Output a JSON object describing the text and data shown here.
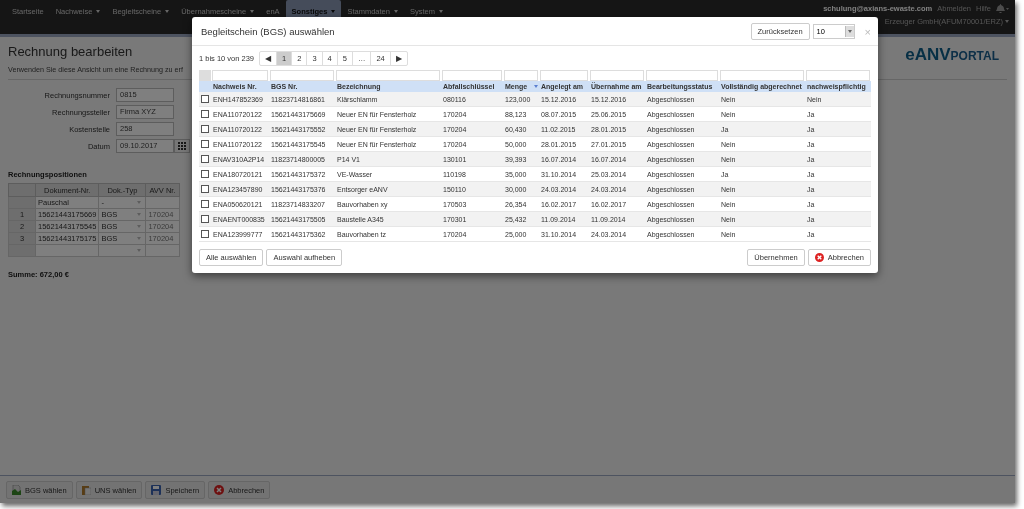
{
  "navbar": {
    "items": [
      {
        "label": "Startseite",
        "dropdown": false,
        "selected": false
      },
      {
        "label": "Nachweise",
        "dropdown": true,
        "selected": false
      },
      {
        "label": "Begleitscheine",
        "dropdown": true,
        "selected": false
      },
      {
        "label": "Übernahmescheine",
        "dropdown": true,
        "selected": false
      },
      {
        "label": "enA",
        "dropdown": false,
        "selected": false
      },
      {
        "label": "Sonstiges",
        "dropdown": true,
        "selected": true
      },
      {
        "label": "Stammdaten",
        "dropdown": true,
        "selected": false
      },
      {
        "label": "System",
        "dropdown": true,
        "selected": false
      }
    ],
    "user": "schulung@axians-ewaste.com",
    "links": [
      "Abmelden",
      "Hilfe"
    ],
    "organisation": "Erzeuger GmbH(AFUM70001/ERZ)"
  },
  "page": {
    "title": "Rechnung bearbeiten",
    "subtitle": "Verwenden Sie diese Ansicht um eine Rechnung zu erf",
    "logo": {
      "part_1": "eANV",
      "part_2": "PORTAL"
    },
    "fields": [
      {
        "label": "Rechnungsnummer",
        "value": "0815",
        "kind": "text"
      },
      {
        "label": "Rechnungssteller",
        "value": "Firma XYZ",
        "kind": "text"
      },
      {
        "label": "Kostenstelle",
        "value": "258",
        "kind": "text"
      },
      {
        "label": "Datum",
        "value": "09.10.2017",
        "kind": "date"
      }
    ],
    "positions_title": "Rechnungspositionen",
    "positions": {
      "columns": [
        "Dokument-Nr.",
        "Dok.-Typ",
        "AVV Nr."
      ],
      "rows": [
        {
          "number": "",
          "cells": [
            "Pauschal",
            "-",
            ""
          ]
        },
        {
          "number": "1",
          "cells": [
            "15621443175669",
            "BGS",
            "170204"
          ]
        },
        {
          "number": "2",
          "cells": [
            "15621443175545",
            "BGS",
            "170204"
          ]
        },
        {
          "number": "3",
          "cells": [
            "15621443175175",
            "BGS",
            "170204"
          ]
        },
        {
          "number": "",
          "cells": [
            "",
            "",
            ""
          ]
        }
      ]
    },
    "sum": "Summe: 672,00 €"
  },
  "toolbar": [
    {
      "label": "BGS wählen",
      "kind": "document"
    },
    {
      "label": "UNS wählen",
      "kind": "clipboard"
    },
    {
      "label": "Speichern",
      "kind": "save"
    },
    {
      "label": "Abbrechen",
      "kind": "cancel"
    }
  ],
  "modal": {
    "title": "Begleitschein (BGS) auswählen",
    "reset_button": "Zurücksetzen",
    "page_size": "10",
    "close": "×",
    "range": "1 bis 10 von 239",
    "pagination": [
      {
        "label": "◀",
        "selected": false
      },
      {
        "label": "1",
        "selected": true
      },
      {
        "label": "2",
        "selected": false
      },
      {
        "label": "3",
        "selected": false
      },
      {
        "label": "4",
        "selected": false
      },
      {
        "label": "5",
        "selected": false
      },
      {
        "label": "…",
        "selected": false
      },
      {
        "label": "24",
        "selected": false
      },
      {
        "label": "▶",
        "selected": false
      }
    ],
    "columns": [
      {
        "label": "Nachweis Nr.",
        "sorted": false
      },
      {
        "label": "BGS Nr.",
        "sorted": false
      },
      {
        "label": "Bezeichnung",
        "sorted": false
      },
      {
        "label": "Abfallschlüssel",
        "sorted": false
      },
      {
        "label": "Menge",
        "sorted": true
      },
      {
        "label": "Angelegt am",
        "sorted": false
      },
      {
        "label": "Übernahme am",
        "sorted": false
      },
      {
        "label": "Bearbeitungsstatus",
        "sorted": false
      },
      {
        "label": "Vollständig abgerechnet",
        "sorted": false
      },
      {
        "label": "nachweispflichtig",
        "sorted": false
      }
    ],
    "rows": [
      {
        "checked": false,
        "cells": [
          "ENH147852369",
          "11823714816861",
          "Klärschlamm",
          "080116",
          "123,000",
          "15.12.2016",
          "15.12.2016",
          "Abgeschlossen",
          "Nein",
          "Nein"
        ]
      },
      {
        "checked": false,
        "cells": [
          "ENA110720122",
          "15621443175669",
          "Neuer EN für Fensterholz",
          "170204",
          "88,123",
          "08.07.2015",
          "25.06.2015",
          "Abgeschlossen",
          "Nein",
          "Ja"
        ]
      },
      {
        "checked": false,
        "cells": [
          "ENA110720122",
          "15621443175552",
          "Neuer EN für Fensterholz",
          "170204",
          "60,430",
          "11.02.2015",
          "28.01.2015",
          "Abgeschlossen",
          "Ja",
          "Ja"
        ]
      },
      {
        "checked": false,
        "cells": [
          "ENA110720122",
          "15621443175545",
          "Neuer EN für Fensterholz",
          "170204",
          "50,000",
          "28.01.2015",
          "27.01.2015",
          "Abgeschlossen",
          "Nein",
          "Ja"
        ]
      },
      {
        "checked": false,
        "cells": [
          "ENAV310A2P14",
          "11823714800005",
          "P14 V1",
          "130101",
          "39,393",
          "16.07.2014",
          "16.07.2014",
          "Abgeschlossen",
          "Nein",
          "Ja"
        ]
      },
      {
        "checked": false,
        "cells": [
          "ENA180720121",
          "15621443175372",
          "VE-Wasser",
          "110198",
          "35,000",
          "31.10.2014",
          "25.03.2014",
          "Abgeschlossen",
          "Ja",
          "Ja"
        ]
      },
      {
        "checked": false,
        "cells": [
          "ENA123457890",
          "15621443175376",
          "Entsorger eANV",
          "150110",
          "30,000",
          "24.03.2014",
          "24.03.2014",
          "Abgeschlossen",
          "Nein",
          "Ja"
        ]
      },
      {
        "checked": false,
        "cells": [
          "ENA050620121",
          "11823714833207",
          "Bauvorhaben xy",
          "170503",
          "26,354",
          "16.02.2017",
          "16.02.2017",
          "Abgeschlossen",
          "Nein",
          "Ja"
        ]
      },
      {
        "checked": false,
        "cells": [
          "ENAENT000835",
          "15621443175505",
          "Baustelle A345",
          "170301",
          "25,432",
          "11.09.2014",
          "11.09.2014",
          "Abgeschlossen",
          "Nein",
          "Ja"
        ]
      },
      {
        "checked": false,
        "cells": [
          "ENA123999777",
          "15621443175362",
          "Bauvorhaben tz",
          "170204",
          "25,000",
          "31.10.2014",
          "24.03.2014",
          "Abgeschlossen",
          "Nein",
          "Ja"
        ]
      }
    ],
    "footer_left": [
      "Alle auswählen",
      "Auswahl aufheben"
    ],
    "apply_button": "Übernehmen",
    "cancel_button": "Abbrechen"
  }
}
